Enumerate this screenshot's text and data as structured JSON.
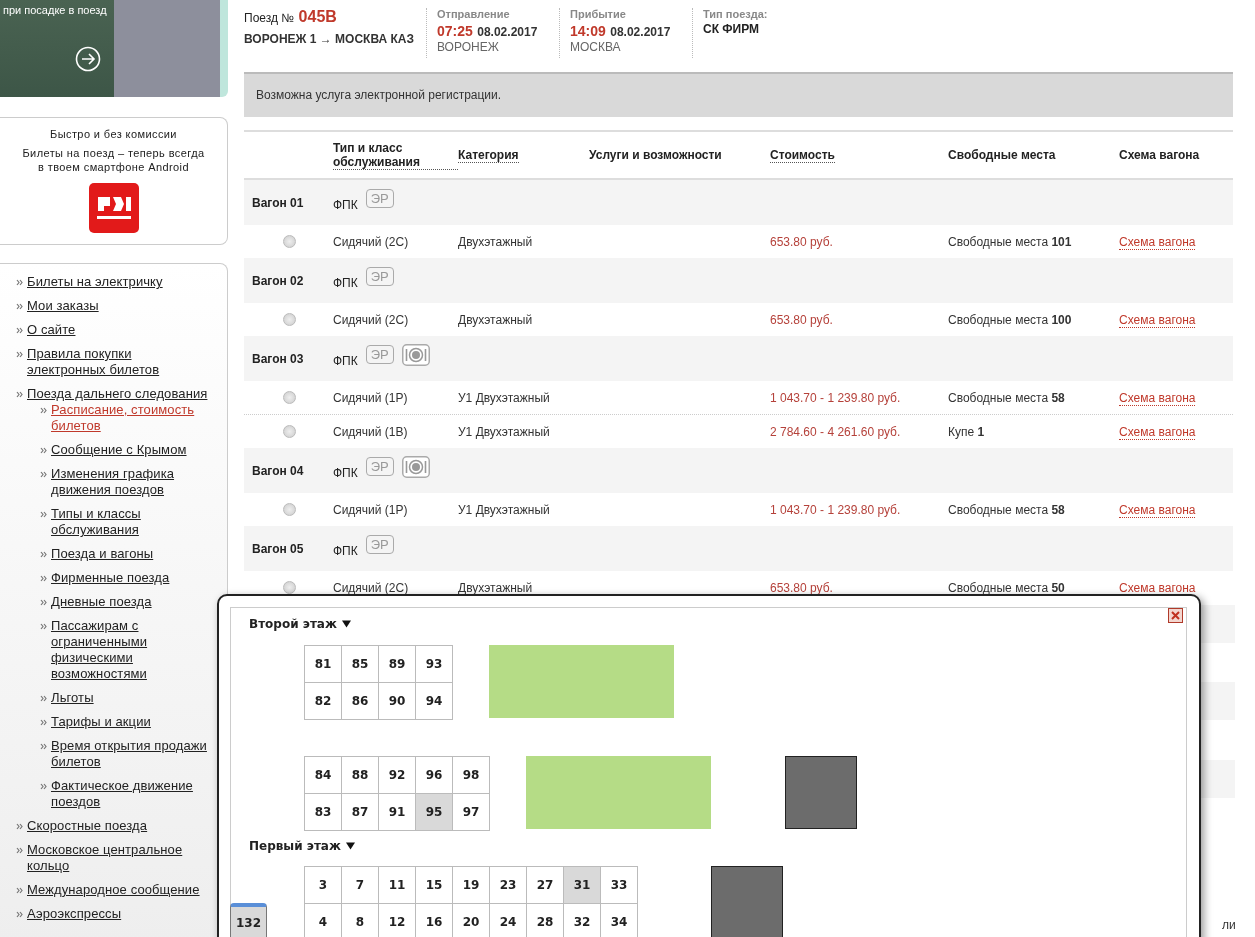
{
  "banner": {
    "text": "при посадке в поезд"
  },
  "promo": {
    "title": "Быстро и без комиссии",
    "text": "Билеты на поезд – теперь всегда в твоем смартфоне Android"
  },
  "nav": [
    {
      "label": "Билеты на электричку",
      "selected": false
    },
    {
      "label": "Мои заказы",
      "selected": false
    },
    {
      "label": "О сайте",
      "selected": false
    },
    {
      "label": "Правила покупки электронных билетов",
      "selected": false
    },
    {
      "label": "Поезда дальнего следования",
      "selected": false,
      "children": [
        {
          "label": "Расписание, стоимость билетов",
          "selected": true
        },
        {
          "label": "Сообщение с Крымом",
          "selected": false
        },
        {
          "label": "Изменения графика движения поездов",
          "selected": false
        },
        {
          "label": "Типы и классы обслуживания",
          "selected": false
        },
        {
          "label": "Поезда и вагоны",
          "selected": false
        },
        {
          "label": "Фирменные поезда",
          "selected": false
        },
        {
          "label": "Дневные поезда",
          "selected": false
        },
        {
          "label": "Пассажирам с ограниченными физическими возможностями",
          "selected": false
        },
        {
          "label": "Льготы",
          "selected": false
        },
        {
          "label": "Тарифы и акции",
          "selected": false
        },
        {
          "label": "Время открытия продажи билетов",
          "selected": false
        },
        {
          "label": "Фактическое движение поездов",
          "selected": false
        }
      ]
    },
    {
      "label": "Скоростные поезда",
      "selected": false
    },
    {
      "label": "Московское центральное кольцо",
      "selected": false
    },
    {
      "label": "Международное сообщение",
      "selected": false
    },
    {
      "label": "Аэроэкспрессы",
      "selected": false
    }
  ],
  "train": {
    "number_label": "Поезд №",
    "number": "045В",
    "route": "ВОРОНЕЖ 1 → МОСКВА КАЗ",
    "departure": {
      "label": "Отправление",
      "time": "07:25",
      "date": "08.02.2017",
      "city": "ВОРОНЕЖ"
    },
    "arrival": {
      "label": "Прибытие",
      "time": "14:09",
      "date": "08.02.2017",
      "city": "МОСКВА"
    },
    "type": {
      "label": "Тип поезда:",
      "value": "СК ФИРМ"
    }
  },
  "notice": "Возможна услуга электронной регистрации.",
  "table": {
    "columns": [
      {
        "label": "Тип и класс обслуживания",
        "sortable": true
      },
      {
        "label": "Категория",
        "sortable": true
      },
      {
        "label": "Услуги и возможности",
        "sortable": false
      },
      {
        "label": "Стоимость",
        "sortable": true
      },
      {
        "label": "Свободные места",
        "sortable": false
      },
      {
        "label": "Схема вагона",
        "sortable": false
      }
    ],
    "wagons": [
      {
        "label": "Вагон 01",
        "carrier": "ФПК",
        "badges": [
          {
            "kind": "text",
            "text": "ЭР"
          }
        ],
        "places": [
          {
            "selected": false,
            "type": "Сидячий (2С)",
            "category": "Двухэтажный",
            "price": "653.80 руб.",
            "seats_label": "Свободные места",
            "seats": "101",
            "scheme": "Схема вагона"
          }
        ]
      },
      {
        "label": "Вагон 02",
        "carrier": "ФПК",
        "badges": [
          {
            "kind": "text",
            "text": "ЭР"
          }
        ],
        "places": [
          {
            "selected": false,
            "type": "Сидячий (2С)",
            "category": "Двухэтажный",
            "price": "653.80 руб.",
            "seats_label": "Свободные места",
            "seats": "100",
            "scheme": "Схема вагона"
          }
        ]
      },
      {
        "label": "Вагон 03",
        "carrier": "ФПК",
        "badges": [
          {
            "kind": "text",
            "text": "ЭР"
          },
          {
            "kind": "dining"
          }
        ],
        "places": [
          {
            "selected": false,
            "type": "Сидячий (1Р)",
            "category": "У1 Двухэтажный",
            "price": "1 043.70 - 1 239.80 руб.",
            "seats_label": "Свободные места",
            "seats": "58",
            "scheme": "Схема вагона"
          },
          {
            "selected": false,
            "type": "Сидячий (1В)",
            "category": "У1 Двухэтажный",
            "price": "2 784.60 - 4 261.60 руб.",
            "seats_label": "Купе",
            "seats": "1",
            "scheme": "Схема вагона"
          }
        ]
      },
      {
        "label": "Вагон 04",
        "carrier": "ФПК",
        "badges": [
          {
            "kind": "text",
            "text": "ЭР"
          },
          {
            "kind": "dining"
          }
        ],
        "places": [
          {
            "selected": false,
            "type": "Сидячий (1Р)",
            "category": "У1 Двухэтажный",
            "price": "1 043.70 - 1 239.80 руб.",
            "seats_label": "Свободные места",
            "seats": "58",
            "scheme": "Схема вагона"
          }
        ]
      },
      {
        "label": "Вагон 05",
        "carrier": "ФПК",
        "badges": [
          {
            "kind": "text",
            "text": "ЭР"
          }
        ],
        "places": [
          {
            "selected": false,
            "type": "Сидячий (2С)",
            "category": "Двухэтажный",
            "price": "653.80 руб.",
            "seats_label": "Свободные места",
            "seats": "50",
            "scheme": "Схема вагона"
          }
        ]
      }
    ]
  },
  "behind_text": "ли",
  "seat_map": {
    "floors": [
      {
        "title": "Второй этаж",
        "expanded": true,
        "blocks": [
          {
            "kind": "seats",
            "rows": [
              [
                {
                  "number": "81",
                  "occupied": false
                },
                {
                  "number": "85",
                  "occupied": false
                },
                {
                  "number": "89",
                  "occupied": false
                },
                {
                  "number": "93",
                  "occupied": false
                }
              ],
              [
                {
                  "number": "82",
                  "occupied": false
                },
                {
                  "number": "86",
                  "occupied": false
                },
                {
                  "number": "90",
                  "occupied": false
                },
                {
                  "number": "94",
                  "occupied": false
                }
              ]
            ]
          },
          {
            "kind": "area"
          },
          {
            "kind": "seats",
            "rows": [
              [
                {
                  "number": "84",
                  "occupied": false
                },
                {
                  "number": "88",
                  "occupied": false
                },
                {
                  "number": "92",
                  "occupied": false
                },
                {
                  "number": "96",
                  "occupied": false
                },
                {
                  "number": "98",
                  "occupied": false
                }
              ],
              [
                {
                  "number": "83",
                  "occupied": false
                },
                {
                  "number": "87",
                  "occupied": false
                },
                {
                  "number": "91",
                  "occupied": false
                },
                {
                  "number": "95",
                  "occupied": true
                },
                {
                  "number": "97",
                  "occupied": false
                }
              ]
            ]
          },
          {
            "kind": "area"
          },
          {
            "kind": "service"
          }
        ]
      },
      {
        "title": "Первый этаж",
        "expanded": true,
        "blocks": [
          {
            "kind": "marker",
            "number": "132"
          },
          {
            "kind": "seats",
            "rows": [
              [
                {
                  "number": "3",
                  "occupied": false
                },
                {
                  "number": "7",
                  "occupied": false
                },
                {
                  "number": "11",
                  "occupied": false
                },
                {
                  "number": "15",
                  "occupied": false
                },
                {
                  "number": "19",
                  "occupied": false
                },
                {
                  "number": "23",
                  "occupied": false
                },
                {
                  "number": "27",
                  "occupied": false
                },
                {
                  "number": "31",
                  "occupied": true
                },
                {
                  "number": "33",
                  "occupied": false
                }
              ],
              [
                {
                  "number": "4",
                  "occupied": false
                },
                {
                  "number": "8",
                  "occupied": false
                },
                {
                  "number": "12",
                  "occupied": false
                },
                {
                  "number": "16",
                  "occupied": false
                },
                {
                  "number": "20",
                  "occupied": false
                },
                {
                  "number": "24",
                  "occupied": false
                },
                {
                  "number": "28",
                  "occupied": false
                },
                {
                  "number": "32",
                  "occupied": false
                },
                {
                  "number": "34",
                  "occupied": false
                }
              ]
            ]
          },
          {
            "kind": "service"
          }
        ]
      }
    ]
  }
}
